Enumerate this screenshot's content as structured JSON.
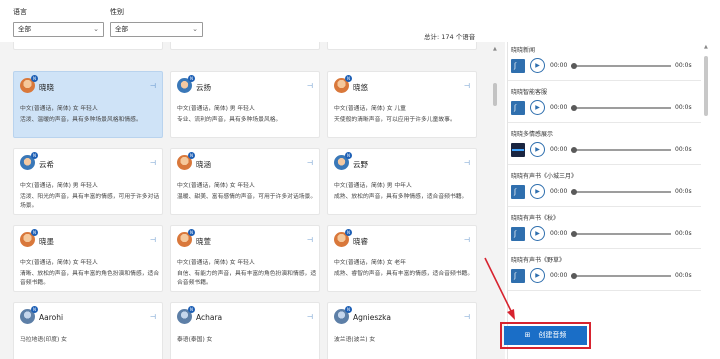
{
  "filters": {
    "language_label": "语言",
    "language_value": "全部",
    "gender_label": "性别",
    "gender_value": "全部"
  },
  "total_label": "总计: 174 个语音",
  "voices": [
    {
      "name": "晓晓",
      "avatar": "female",
      "attrs": "中文(普通话，简体)   女   年轻人",
      "desc": "活泼、温暖的声音，具有多种场景风格和情感。",
      "selected": true
    },
    {
      "name": "云扬",
      "avatar": "male",
      "attrs": "中文(普通话，简体)   男   年轻人",
      "desc": "专业、流利的声音，具有多种场景风格。",
      "selected": false
    },
    {
      "name": "晓悠",
      "avatar": "female",
      "attrs": "中文(普通话，简体)   女   儿童",
      "desc": "天使般的清晰声音，可以应用于许多儿童故事。",
      "selected": false
    },
    {
      "name": "云希",
      "avatar": "male",
      "attrs": "中文(普通话，简体)   男   年轻人",
      "desc": "活泼、阳光的声音，具有丰富的情感，可用于许多对话场景。",
      "selected": false
    },
    {
      "name": "晓涵",
      "avatar": "female",
      "attrs": "中文(普通话，简体)   女   年轻人",
      "desc": "温暖、甜美、富有感情的声音，可用于许多对话场景。",
      "selected": false
    },
    {
      "name": "云野",
      "avatar": "male",
      "attrs": "中文(普通话，简体)   男   中年人",
      "desc": "成熟、放松的声音，具有多种情感，适合音频书籍。",
      "selected": false
    },
    {
      "name": "晓墨",
      "avatar": "female",
      "attrs": "中文(普通话，简体)   女   年轻人",
      "desc": "清晰、放松的声音，具有丰富的角色扮演和情感，适合音频书籍。",
      "selected": false
    },
    {
      "name": "晓萱",
      "avatar": "female",
      "attrs": "中文(普通话，简体)   女   年轻人",
      "desc": "自信、有能力的声音，具有丰富的角色扮演和情感，适合音频书籍。",
      "selected": false
    },
    {
      "name": "晓睿",
      "avatar": "female",
      "attrs": "中文(普通话，简体)   女   老年",
      "desc": "成熟、睿智的声音，具有丰富的情感，适合音频书籍。",
      "selected": false
    },
    {
      "name": "Aarohi",
      "avatar": "plain",
      "attrs": "马拉地语(印度)   女",
      "desc": "",
      "selected": false
    },
    {
      "name": "Achara",
      "avatar": "plain",
      "attrs": "泰语(泰国)   女",
      "desc": "",
      "selected": false
    },
    {
      "name": "Agnieszka",
      "avatar": "plain",
      "attrs": "波兰语(波兰)   女",
      "desc": "",
      "selected": false
    }
  ],
  "samples": [
    {
      "title": "晓晓新闻",
      "start": "00:00",
      "end": "00:0s",
      "thumb": "ear"
    },
    {
      "title": "晓晓智能客服",
      "start": "00:00",
      "end": "00:0s",
      "thumb": "ear"
    },
    {
      "title": "晓晓多情感展示",
      "start": "00:00",
      "end": "00:0s",
      "thumb": "wave"
    },
    {
      "title": "晓晓有声书《小城三月》",
      "start": "00:00",
      "end": "00:0s",
      "thumb": "ear"
    },
    {
      "title": "晓晓有声书《秋》",
      "start": "00:00",
      "end": "00:0s",
      "thumb": "ear"
    },
    {
      "title": "晓晓有声书《野草》",
      "start": "00:00",
      "end": "00:0s",
      "thumb": "ear"
    }
  ],
  "create_button": {
    "label": "创建音频",
    "icon": "plus-box-icon"
  },
  "colors": {
    "accent": "#1a6ec7",
    "selected_card": "#cfe3f7",
    "highlight_frame": "#d7232f",
    "arrow": "#d7232f"
  }
}
